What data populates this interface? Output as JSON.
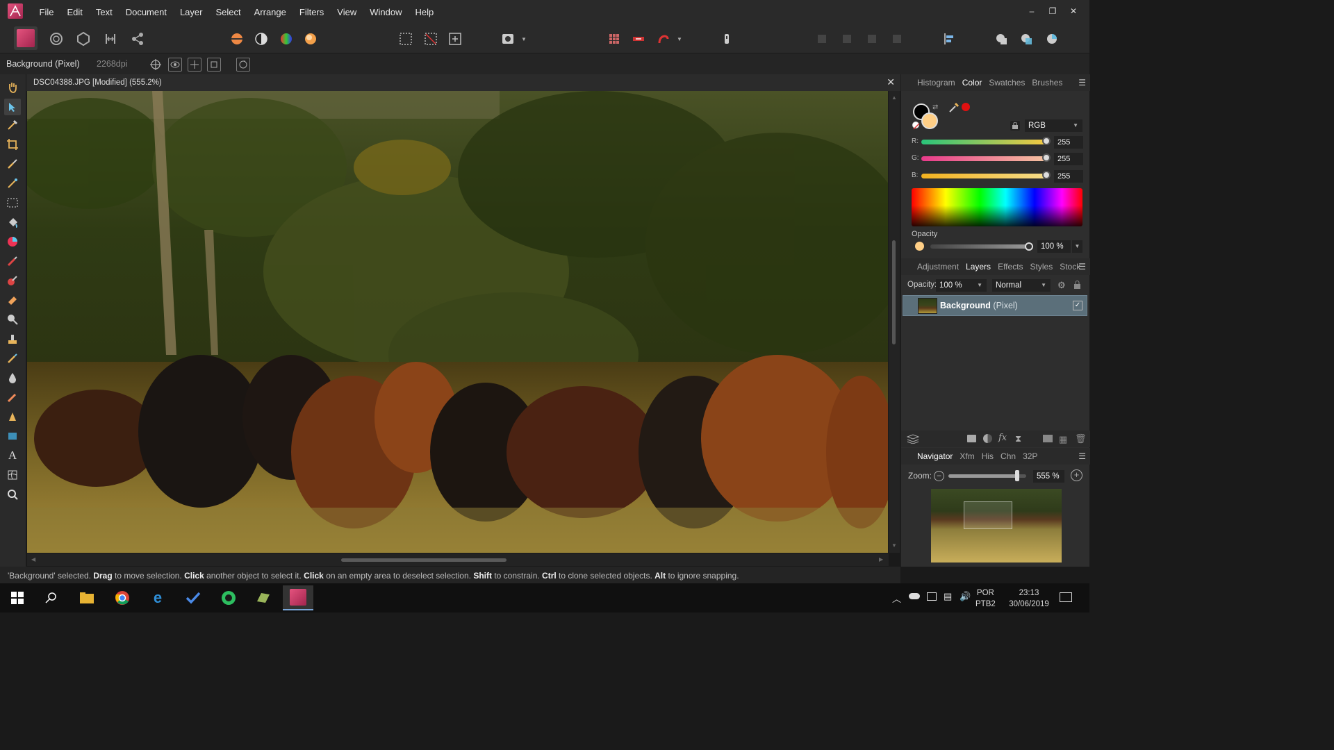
{
  "menubar": {
    "items": [
      "File",
      "Edit",
      "Text",
      "Document",
      "Layer",
      "Select",
      "Arrange",
      "Filters",
      "View",
      "Window",
      "Help"
    ],
    "window_controls": [
      "–",
      "❐",
      "✕"
    ]
  },
  "context_bar": {
    "layer_label": "Background (Pixel)",
    "dpi": "2268dpi"
  },
  "document": {
    "title": "DSC04388.JPG [Modified] (555.2%)",
    "close": "✕"
  },
  "color_panel": {
    "tabs": [
      "Histogram",
      "Color",
      "Swatches",
      "Brushes"
    ],
    "active_tab": "Color",
    "mode": "RGB",
    "channels": [
      {
        "label": "R:",
        "value": "255"
      },
      {
        "label": "G:",
        "value": "255"
      },
      {
        "label": "B:",
        "value": "255"
      }
    ],
    "opacity_label": "Opacity",
    "opacity_value": "100 %",
    "fill_color": "#ffcf86",
    "accent_red": "#e01010"
  },
  "layers_panel": {
    "tabs": [
      "Adjustment",
      "Layers",
      "Effects",
      "Styles",
      "Stock"
    ],
    "active_tab": "Layers",
    "opacity_label": "Opacity:",
    "opacity_value": "100 %",
    "blend_mode": "Normal",
    "layers": [
      {
        "name": "Background",
        "type": "(Pixel)",
        "visible": "✓"
      }
    ]
  },
  "navigator_panel": {
    "tabs": [
      "Navigator",
      "Xfm",
      "His",
      "Chn",
      "32P"
    ],
    "active_tab": "Navigator",
    "zoom_label": "Zoom:",
    "zoom_value": "555 %",
    "zoom_fraction": 0.88
  },
  "status_bar": {
    "segments": [
      {
        "text": "'Background' selected. ",
        "bold": false
      },
      {
        "text": "Drag",
        "bold": true
      },
      {
        "text": " to move selection. ",
        "bold": false
      },
      {
        "text": "Click",
        "bold": true
      },
      {
        "text": " another object to select it. ",
        "bold": false
      },
      {
        "text": "Click",
        "bold": true
      },
      {
        "text": " on an empty area to deselect selection. ",
        "bold": false
      },
      {
        "text": "Shift",
        "bold": true
      },
      {
        "text": " to constrain. ",
        "bold": false
      },
      {
        "text": "Ctrl",
        "bold": true
      },
      {
        "text": " to clone selected objects. ",
        "bold": false
      },
      {
        "text": "Alt",
        "bold": true
      },
      {
        "text": " to ignore snapping.",
        "bold": false
      }
    ]
  },
  "taskbar": {
    "apps": [
      "windows-start",
      "search",
      "file-explorer",
      "chrome",
      "edge",
      "todo",
      "evernote",
      "notes",
      "affinity-photo"
    ],
    "language": "POR",
    "layout": "PTB2",
    "time": "23:13",
    "date": "30/06/2019"
  }
}
